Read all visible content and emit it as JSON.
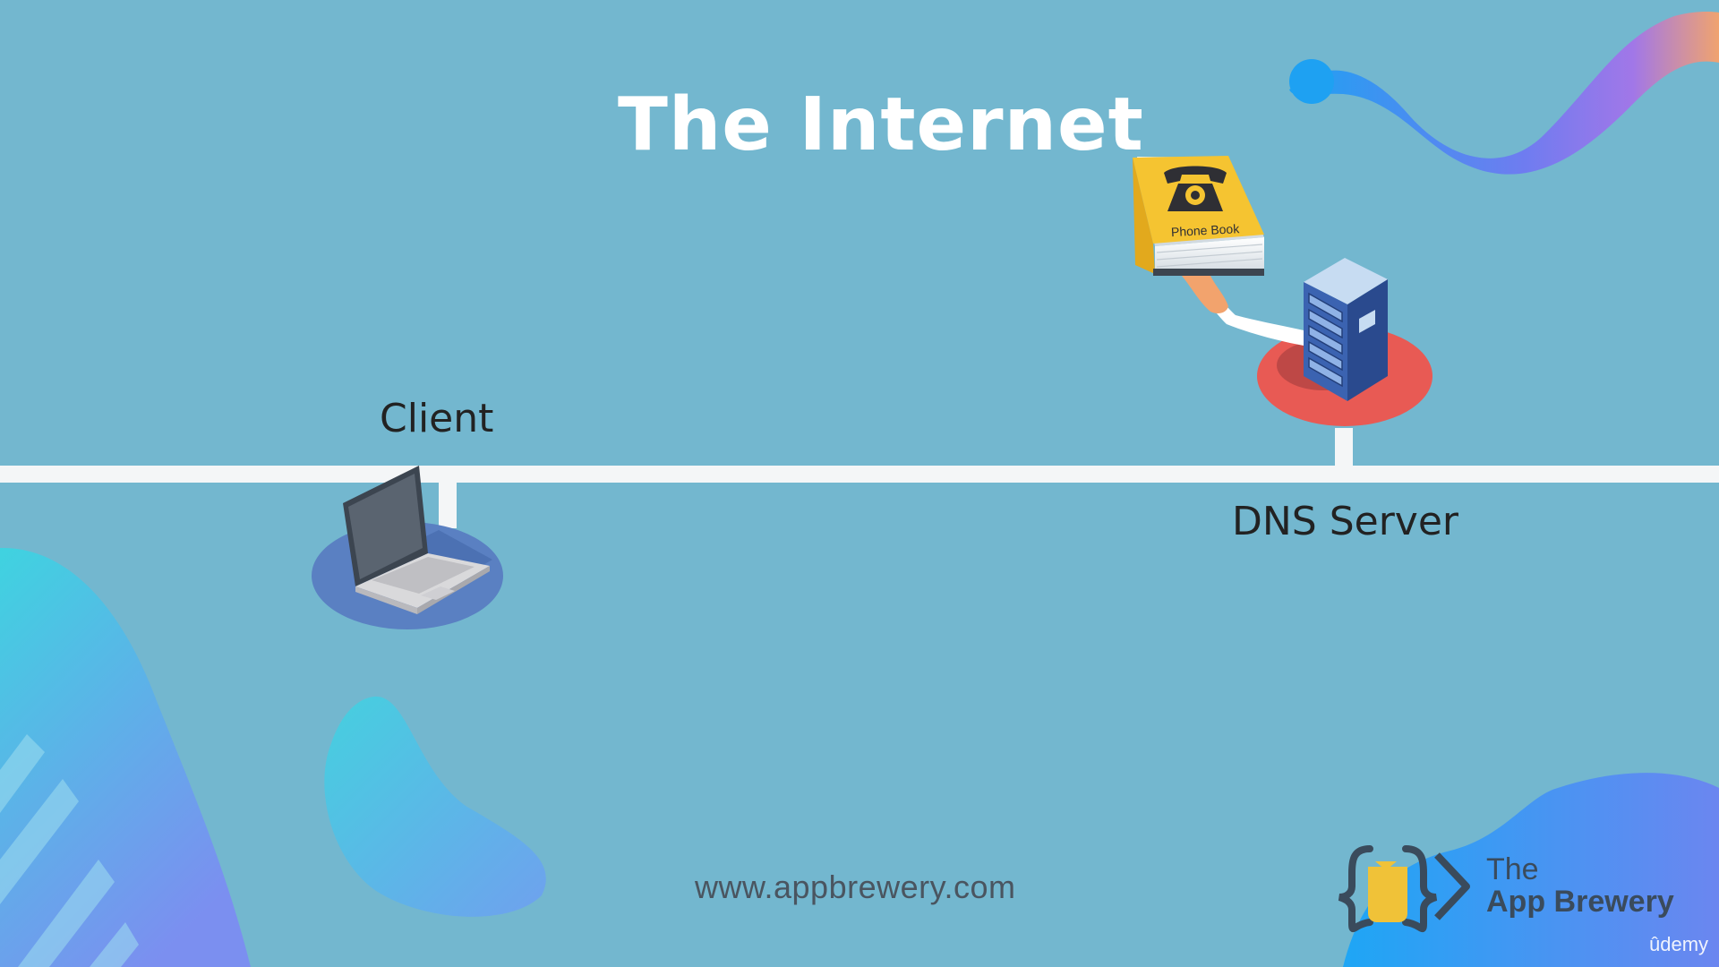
{
  "slide": {
    "title": "The Internet",
    "client_label": "Client",
    "dns_label": "DNS Server",
    "book_label": "Phone Book",
    "footer_url": "www.appbrewery.com",
    "brand_the": "The",
    "brand_name": "App Brewery",
    "watermark": "ûdemy"
  },
  "colors": {
    "background": "#73b7cf",
    "network_line": "#f4f6f7",
    "client_disc": "#5a80c2",
    "server_disc": "#e85a54",
    "book": "#f5c431",
    "server": "#3b63b1"
  }
}
